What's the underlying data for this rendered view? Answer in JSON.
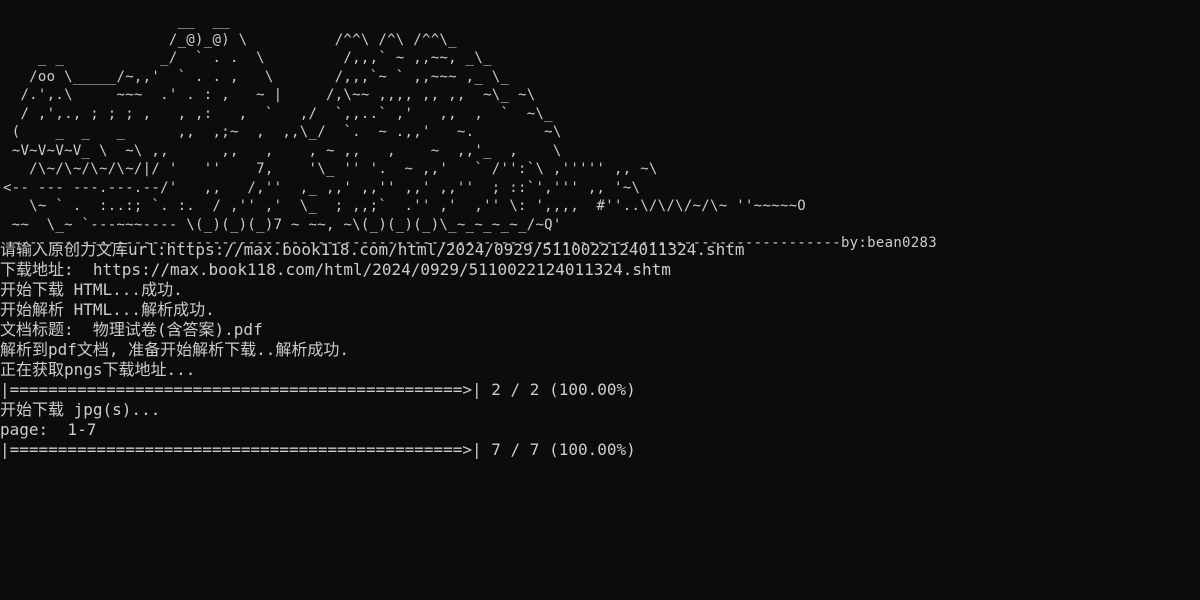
{
  "banner": {
    "art_lines": [
      "                    __  __",
      "                   /_@)_@) \\          /^^\\ /^\\ /^^\\_",
      "    _ _           _/  ` . .  \\         /,,,` ~ ,,~~, _\\_",
      "   /oo \\_____/~,,'  ` . . ,   \\       /,,,`~ ` ,,~~~ ,_ \\_",
      "  /.',.\\     ~~~  .' . : ,   ~ |     /,\\~~ ,,,, ,, ,,  ~\\_ ~\\",
      "  / ,',., ; ; ; ,   , ,:   ,  `   ,/  `,,..` ,'   ,,  ,  `  ~\\_",
      " (    _  _   _      ,,  ,;~  ,  ,,\\_/  `.  ~ .,,'   ~.        ~\\",
      " ~V~V~V~V_ \\  ~\\ ,,      ,,   ,    , ~ ,,   ,    ~  ,,'_  ,    \\",
      "   /\\~/\\~/\\~/\\~/|/ '   ''    7,    '\\_ '' '.  ~ ,,'   ` /'':`\\ ,''''' ,, ~\\",
      "<-- --- ---.---.--/'   ,,   /,''  ,_ ,,' ,,'' ,,' ,,''  ; ::`',''' ,, '~\\",
      "   \\~ ` .  :..:; `. :.  / ,'' ,'  \\_  ; ,,;`  .'' ,'  ,'' \\: ',,,,  #''..\\/\\/\\/~/\\~ ''~~~~~O",
      " ~~  \\_~ `---~~~---- \\(_)(_)(_)7 ~ ~~, ~\\(_)(_)(_)\\_~_~_~_~_/~Q'",
      " -----------------------------------------------------------------------------------------------by:bean0283"
    ]
  },
  "log": {
    "prompt_url": "请输入原创力文库url:https://max.book118.com/html/2024/0929/5110022124011324.shtm",
    "download_address": "下载地址:  https://max.book118.com/html/2024/0929/5110022124011324.shtm",
    "start_download_html": "开始下载 HTML...成功.",
    "start_parse_html": "开始解析 HTML...解析成功.",
    "doc_title": "文档标题:  物理试卷(含答案).pdf",
    "parsed_pdf": "解析到pdf文档, 准备开始解析下载..解析成功.",
    "fetching_pngs": "正在获取pngs下载地址...",
    "progress_1": "|===============================================>| 2 / 2 (100.00%)",
    "start_download_jpg": "开始下载 jpg(s)...",
    "page_range": "page:  1-7",
    "progress_2": "|===============================================>| 7 / 7 (100.00%)"
  },
  "colors": {
    "background": "#0c0c0c",
    "foreground": "#cccccc"
  }
}
